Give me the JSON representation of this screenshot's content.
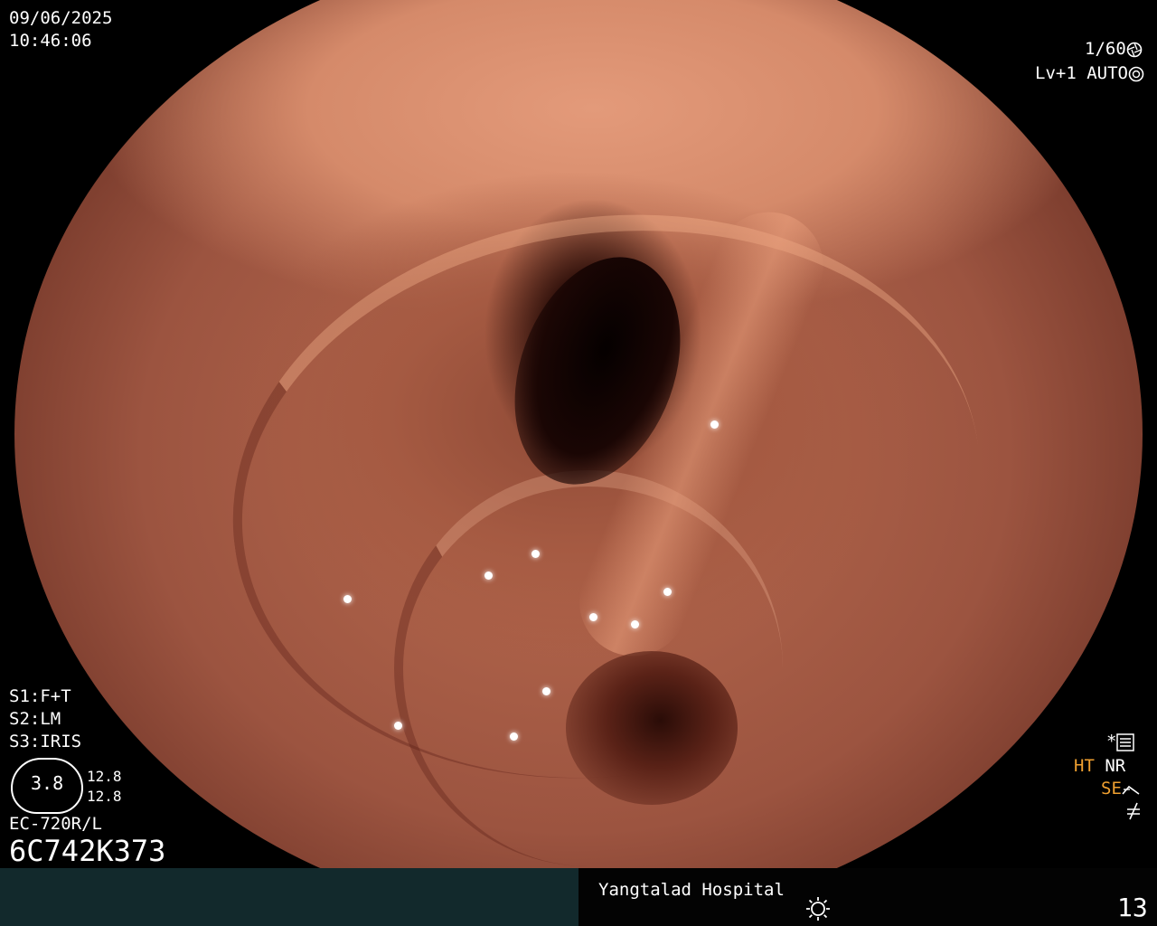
{
  "overlay": {
    "date": "09/06/2025",
    "time": "10:46:06",
    "shutter": "1/60",
    "level": "Lv+1",
    "exposure_mode": "AUTO",
    "s1": "S1:F+T",
    "s2": "S2:LM",
    "s3": "S3:IRIS",
    "gauge_value": "3.8",
    "gauge_top": "12.8",
    "gauge_bottom": "12.8",
    "scope_model": "EC-720R/L",
    "serial": "6C742K373",
    "ht": "HT",
    "nr": "NR",
    "se": "SE",
    "hospital": "Yangtalad Hospital",
    "image_number": "13"
  },
  "icons": {
    "shutter": "aperture-icon",
    "auto": "camera-auto-icon",
    "menu": "settings-list-icon",
    "sun": "light-source-icon"
  },
  "colors": {
    "accent_orange": "#f0a030",
    "bar_dark": "#12292c"
  }
}
